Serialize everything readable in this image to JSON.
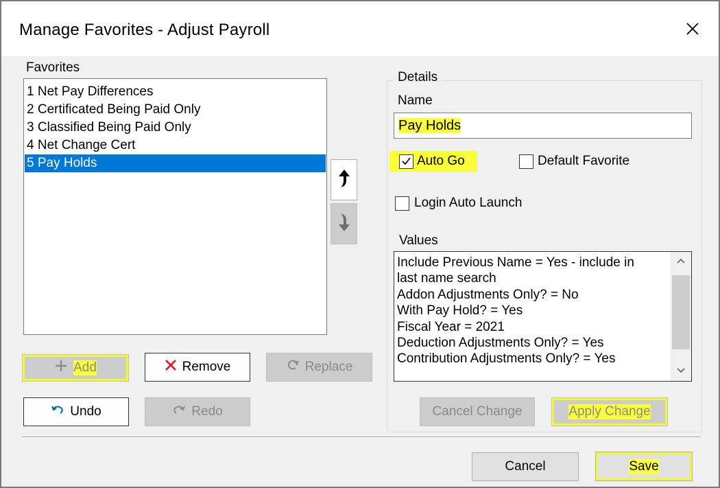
{
  "window": {
    "title": "Manage Favorites - Adjust Payroll"
  },
  "favorites": {
    "label": "Favorites",
    "items": [
      "1 Net Pay Differences",
      "2 Certificated Being Paid Only",
      "3 Classified Being Paid Only",
      "4 Net Change Cert",
      "5 Pay Holds"
    ],
    "selected_index": 4
  },
  "buttons": {
    "add": "Add",
    "remove": "Remove",
    "replace": "Replace",
    "undo": "Undo",
    "redo": "Redo",
    "cancel_change": "Cancel Change",
    "apply_change": "Apply Change",
    "cancel": "Cancel",
    "save": "Save"
  },
  "details": {
    "legend": "Details",
    "name_label": "Name",
    "name_value": "Pay Holds",
    "auto_go": {
      "label": "Auto Go",
      "checked": true
    },
    "default_favorite": {
      "label": "Default Favorite",
      "checked": false
    },
    "login_auto_launch": {
      "label": "Login Auto Launch",
      "checked": false
    },
    "values_label": "Values",
    "values_lines": [
      "Include Previous Name = Yes - include in",
      "last name search",
      "Addon Adjustments Only? = No",
      "With Pay Hold? = Yes",
      "Fiscal Year = 2021",
      "Deduction Adjustments Only? = Yes",
      "Contribution Adjustments Only? = Yes"
    ]
  },
  "colors": {
    "highlight": "#fbff3a",
    "selection": "#0078d7",
    "remove_icon": "#e81123"
  },
  "icons": {
    "close": "close-icon",
    "move_up": "arrow-up-icon",
    "move_down": "arrow-down-icon",
    "add": "plus-icon",
    "remove": "x-icon",
    "replace": "refresh-icon",
    "undo": "undo-icon",
    "redo": "redo-icon"
  }
}
